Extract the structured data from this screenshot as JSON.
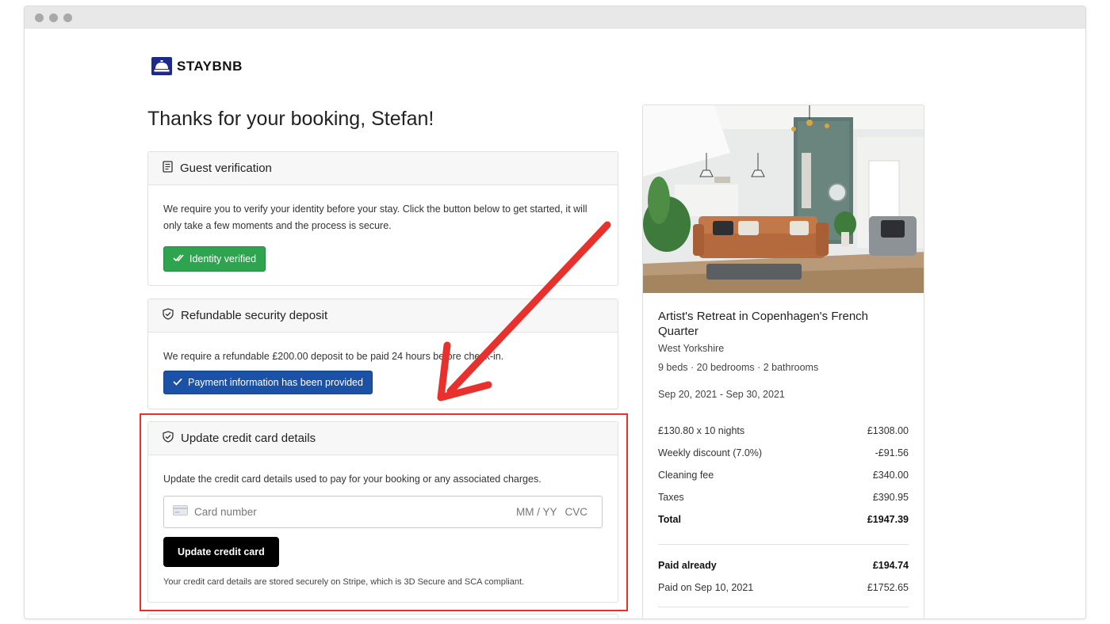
{
  "brand": {
    "name": "STAYBNB"
  },
  "page": {
    "title": "Thanks for your booking, Stefan!"
  },
  "guest_verification": {
    "heading": "Guest verification",
    "text": "We require you to verify your identity before your stay. Click the button below to get started, it will only take a few moments and the process is secure.",
    "button_label": "Identity verified"
  },
  "security_deposit": {
    "heading": "Refundable security deposit",
    "text": "We require a refundable £200.00 deposit to be paid 24 hours before check-in.",
    "button_label": "Payment information has been provided"
  },
  "credit_card": {
    "heading": "Update credit card details",
    "text": "Update the credit card details used to pay for your booking or any associated charges.",
    "card_placeholder": "Card number",
    "expiry_placeholder": "MM / YY",
    "cvc_placeholder": "CVC",
    "button_label": "Update credit card",
    "note": "Your credit card details are stored securely on Stripe, which is 3D Secure and SCA compliant."
  },
  "listing": {
    "title": "Artist's Retreat in Copenhagen's French Quarter",
    "location": "West Yorkshire",
    "specs": "9 beds · 20 bedrooms · 2 bathrooms",
    "dates": "Sep 20, 2021 - Sep 30, 2021",
    "prices": [
      {
        "label": "£130.80 x 10 nights",
        "value": "£1308.00"
      },
      {
        "label": "Weekly discount (7.0%)",
        "value": "-£91.56"
      },
      {
        "label": "Cleaning fee",
        "value": "£340.00"
      },
      {
        "label": "Taxes",
        "value": "£390.95"
      },
      {
        "label": "Total",
        "value": "£1947.39"
      }
    ],
    "paid": [
      {
        "label": "Paid already",
        "value": "£194.74"
      },
      {
        "label": "Paid on Sep 10, 2021",
        "value": "£1752.65"
      }
    ]
  },
  "colors": {
    "brand": "#1e2a8a",
    "success": "#2ea44f",
    "primary": "#1b52a8",
    "annotation": "#e8312d"
  }
}
